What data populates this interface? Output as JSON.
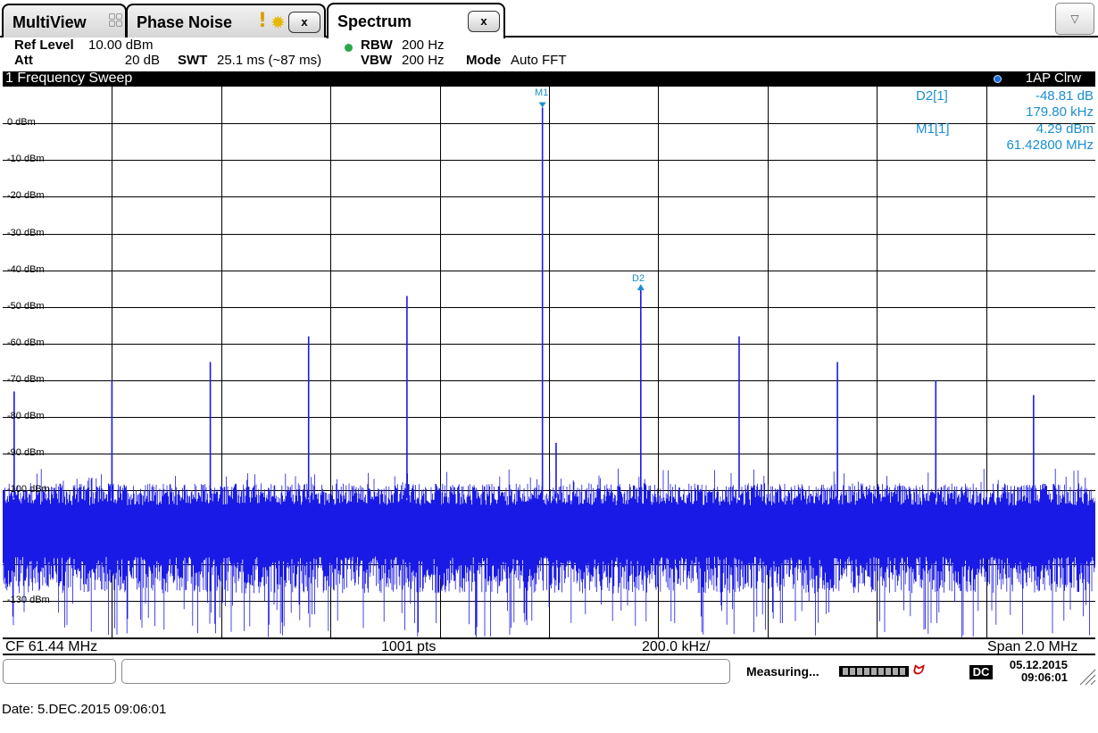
{
  "tabs": [
    {
      "label": "MultiView"
    },
    {
      "label": "Phase Noise",
      "close": "x"
    },
    {
      "label": "Spectrum",
      "close": "x"
    }
  ],
  "menu_icon": "chevron-down-icon",
  "settings": {
    "ref_level_label": "Ref Level",
    "ref_level_value": "10.00 dBm",
    "att_label": "Att",
    "att_value": "20 dB",
    "swt_label": "SWT",
    "swt_value": "25.1 ms (~87 ms)",
    "rbw_label": "RBW",
    "rbw_value": "200 Hz",
    "vbw_label": "VBW",
    "vbw_value": "200 Hz",
    "mode_label": "Mode",
    "mode_value": "Auto FFT"
  },
  "window": {
    "title": "1 Frequency Sweep",
    "trace": "1AP Clrw"
  },
  "markers": {
    "m1_label": "M1",
    "d2_label": "D2",
    "readouts": [
      {
        "name": "D2[1]",
        "value": "-48.81 dB",
        "freq": "179.80 kHz"
      },
      {
        "name": "M1[1]",
        "value": "4.29 dBm",
        "freq": "61.42800 MHz"
      }
    ]
  },
  "footer": {
    "cf": "CF 61.44 MHz",
    "pts": "1001 pts",
    "div": "200.0 kHz/",
    "span": "Span 2.0 MHz"
  },
  "status": {
    "text": "Measuring...",
    "dc": "DC",
    "date": "05.12.2015",
    "time": "09:06:01"
  },
  "date_line": "Date: 5.DEC.2015  09:06:01",
  "colors": {
    "trace": "#1a1ae6",
    "marker": "#1a8fd0",
    "grid": "#000000"
  },
  "chart_data": {
    "type": "line",
    "xlabel": "",
    "ylabel": "",
    "center_freq_mhz": 61.44,
    "span_mhz": 2.0,
    "ylim": [
      -140,
      10
    ],
    "y_ticks": [
      "0 dBm",
      "-10 dBm",
      "-20 dBm",
      "-30 dBm",
      "-40 dBm",
      "-50 dBm",
      "-60 dBm",
      "-70 dBm",
      "-80 dBm",
      "-90 dBm",
      "-100 dBm",
      "-130 dBm"
    ],
    "y_tick_values": [
      0,
      -10,
      -20,
      -30,
      -40,
      -50,
      -60,
      -70,
      -80,
      -90,
      -100,
      -130
    ],
    "noise_floor_dbm": -108,
    "peaks": [
      {
        "freq_mhz": 60.461,
        "level_dbm": -73
      },
      {
        "freq_mhz": 60.64,
        "level_dbm": -70
      },
      {
        "freq_mhz": 60.82,
        "level_dbm": -65
      },
      {
        "freq_mhz": 61.0,
        "level_dbm": -58
      },
      {
        "freq_mhz": 61.18,
        "level_dbm": -47
      },
      {
        "freq_mhz": 61.428,
        "level_dbm": 4.29
      },
      {
        "freq_mhz": 61.453,
        "level_dbm": -87
      },
      {
        "freq_mhz": 61.608,
        "level_dbm": -44.5
      },
      {
        "freq_mhz": 61.788,
        "level_dbm": -58
      },
      {
        "freq_mhz": 61.968,
        "level_dbm": -65
      },
      {
        "freq_mhz": 62.148,
        "level_dbm": -70
      },
      {
        "freq_mhz": 62.327,
        "level_dbm": -74
      }
    ]
  }
}
